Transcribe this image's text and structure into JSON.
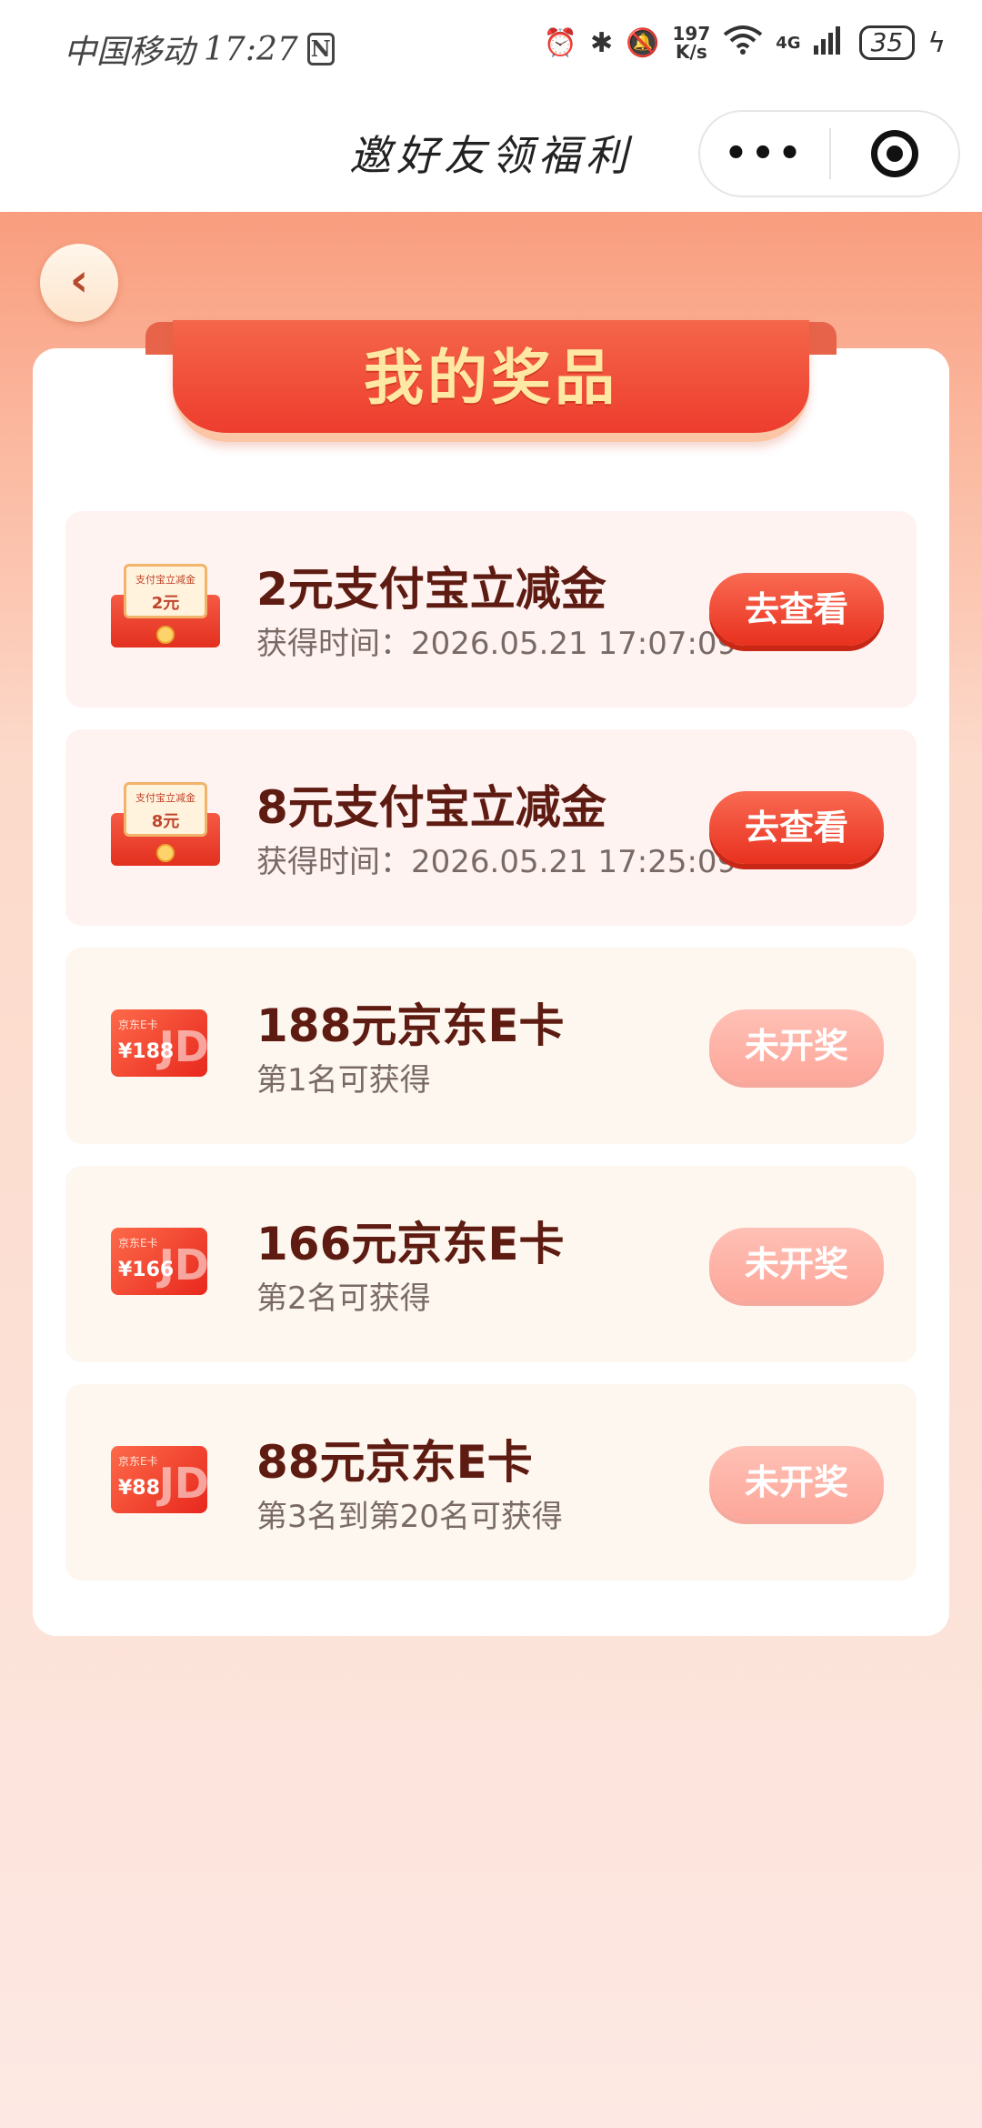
{
  "status_bar": {
    "carrier": "中国移动",
    "time": "17:27",
    "nfc": "N",
    "net_speed_value": "197",
    "net_speed_unit": "K/s",
    "network": "4G",
    "battery": "35"
  },
  "title_bar": {
    "title": "邀好友领福利",
    "more_label": "•••"
  },
  "page": {
    "back_label": "‹",
    "banner_title": "我的奖品"
  },
  "prizes": [
    {
      "title": "2元支付宝立减金",
      "subtitle": "获得时间：2026.05.21 17:07:09",
      "button": "去查看",
      "thumb_label": "支付宝立减金",
      "thumb_amount": "2元"
    },
    {
      "title": "8元支付宝立减金",
      "subtitle": "获得时间：2026.05.21 17:25:09",
      "button": "去查看",
      "thumb_label": "支付宝立减金",
      "thumb_amount": "8元"
    },
    {
      "title": "188元京东E卡",
      "subtitle": "第1名可获得",
      "button": "未开奖",
      "thumb_label": "京东E卡",
      "thumb_amount": "¥188"
    },
    {
      "title": "166元京东E卡",
      "subtitle": "第2名可获得",
      "button": "未开奖",
      "thumb_label": "京东E卡",
      "thumb_amount": "¥166"
    },
    {
      "title": "88元京东E卡",
      "subtitle": "第3名到第20名可获得",
      "button": "未开奖",
      "thumb_label": "京东E卡",
      "thumb_amount": "¥88"
    }
  ],
  "jd_logo": "JD"
}
